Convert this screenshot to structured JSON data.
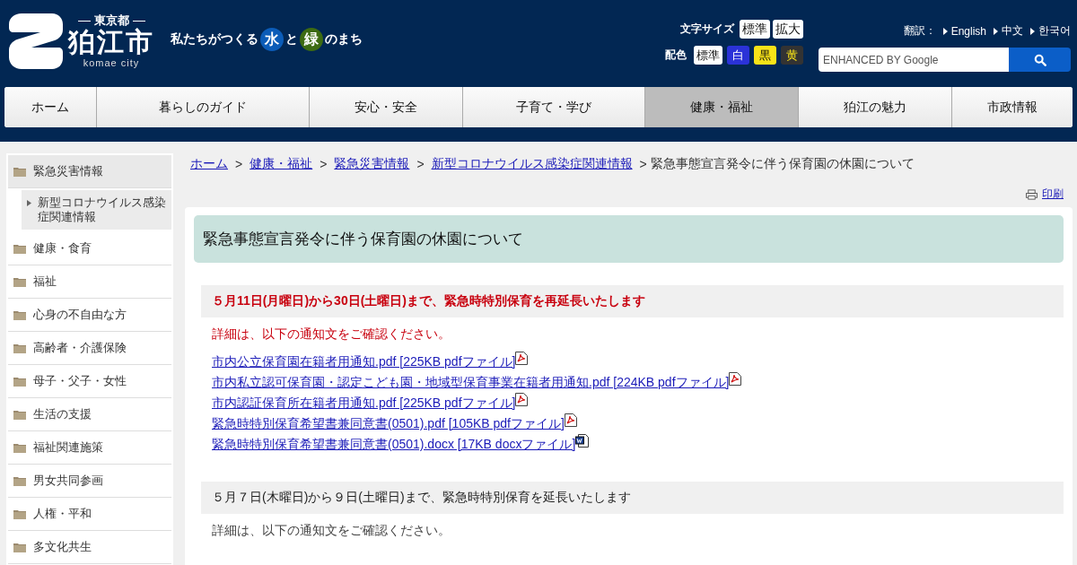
{
  "header": {
    "prefecture": "東京都",
    "city": "狛江市",
    "city_roman": "komae city",
    "tagline": [
      {
        "kind": "text",
        "text": "私たちがつくる"
      },
      {
        "kind": "circle",
        "text": "水",
        "color": "#0b5cb8"
      },
      {
        "kind": "text",
        "text": "と"
      },
      {
        "kind": "circle",
        "text": "緑",
        "color": "#3d6b12"
      },
      {
        "kind": "text",
        "text": "のまち"
      }
    ],
    "font_size": {
      "label": "文字サイズ",
      "options": [
        "標準",
        "拡大"
      ]
    },
    "color_scheme": {
      "label": "配色",
      "options": [
        {
          "label": "標準",
          "kind": "default"
        },
        {
          "label": "白",
          "kind": "blue"
        },
        {
          "label": "黒",
          "kind": "yellow"
        },
        {
          "label": "黄",
          "kind": "dark"
        }
      ]
    },
    "translate": {
      "label": "翻訳：",
      "languages": [
        "English",
        "中文",
        "한국어"
      ]
    },
    "search": {
      "placeholder": "ENHANCED BY Google"
    }
  },
  "nav": [
    {
      "label": "ホーム",
      "selected": false
    },
    {
      "label": "暮らしのガイド",
      "selected": false
    },
    {
      "label": "安心・安全",
      "selected": false
    },
    {
      "label": "子育て・学び",
      "selected": false
    },
    {
      "label": "健康・福祉",
      "selected": true
    },
    {
      "label": "狛江の魅力",
      "selected": false
    },
    {
      "label": "市政情報",
      "selected": false
    }
  ],
  "sidebar": {
    "items": [
      {
        "label": "緊急災害情報",
        "selected": true,
        "children": [
          {
            "label": "新型コロナウイルス感染症関連情報",
            "selected": false
          }
        ]
      },
      {
        "label": "健康・食育",
        "selected": false
      },
      {
        "label": "福祉",
        "selected": false
      },
      {
        "label": "心身の不自由な方",
        "selected": false
      },
      {
        "label": "高齢者・介護保険",
        "selected": false
      },
      {
        "label": "母子・父子・女性",
        "selected": false
      },
      {
        "label": "生活の支援",
        "selected": false
      },
      {
        "label": "福祉関連施策",
        "selected": false
      },
      {
        "label": "男女共同参画",
        "selected": false
      },
      {
        "label": "人権・平和",
        "selected": false
      },
      {
        "label": "多文化共生",
        "selected": false
      }
    ]
  },
  "breadcrumb": [
    {
      "kind": "link",
      "text": "ホーム"
    },
    {
      "kind": "separator",
      "text": ">"
    },
    {
      "kind": "link",
      "text": "健康・福祉"
    },
    {
      "kind": "separator",
      "text": ">"
    },
    {
      "kind": "link",
      "text": "緊急災害情報"
    },
    {
      "kind": "separator",
      "text": ">"
    },
    {
      "kind": "link",
      "text": "新型コロナウイルス感染症関連情報"
    },
    {
      "kind": "separator",
      "text": ">"
    },
    {
      "kind": "current",
      "text": "緊急事態宣言発令に伴う保育園の休園について"
    }
  ],
  "print": "印刷",
  "article": {
    "title": "緊急事態宣言発令に伴う保育園の休園について",
    "sections": [
      {
        "heading": "５月11日(月曜日)から30日(土曜日)まで、緊急時特別保育を再延長いたします",
        "emphasis": true,
        "note": "詳細は、以下の通知文をご確認ください。",
        "links": [
          {
            "text": "市内公立保育園在籍者用通知.pdf [225KB pdfファイル]",
            "kind": "pdf"
          },
          {
            "text": "市内私立認可保育園・認定こども園・地域型保育事業在籍者用通知.pdf [224KB pdfファイル]",
            "kind": "pdf"
          },
          {
            "text": "市内認証保育所在籍者用通知.pdf [225KB pdfファイル]",
            "kind": "pdf"
          },
          {
            "text": "緊急時特別保育希望書兼同意書(0501).pdf [105KB pdfファイル]",
            "kind": "pdf"
          },
          {
            "text": "緊急時特別保育希望書兼同意書(0501).docx [17KB docxファイル]",
            "kind": "docx"
          }
        ]
      },
      {
        "heading": "５月７日(木曜日)から９日(土曜日)まで、緊急時特別保育を延長いたします",
        "emphasis": false,
        "note": "詳細は、以下の通知文をご確認ください。"
      }
    ]
  }
}
